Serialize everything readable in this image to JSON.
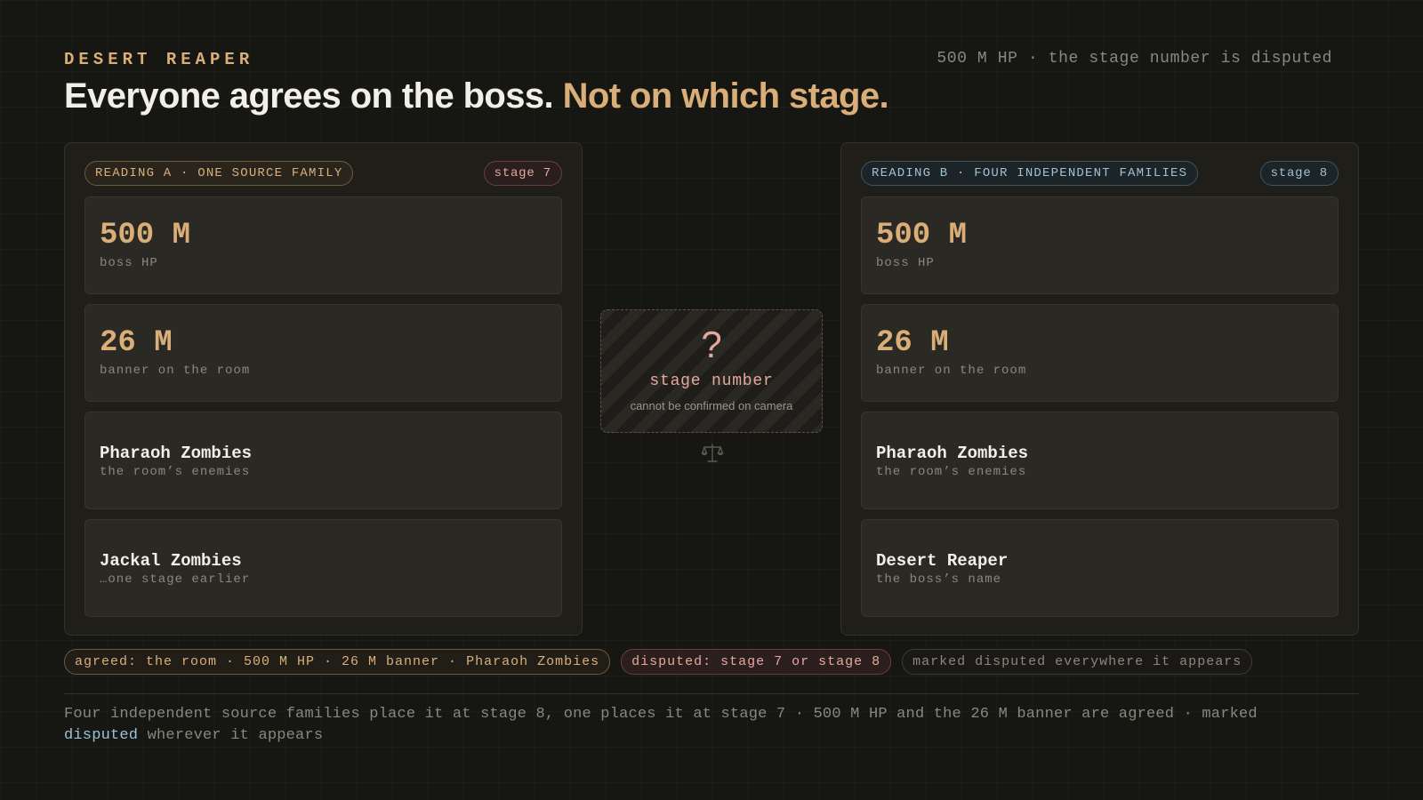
{
  "header": {
    "eyebrow": "DESERT REAPER",
    "meta": "500 M HP · the stage number is disputed",
    "headline_main": "Everyone agrees on the boss.",
    "headline_accent": "Not on which stage."
  },
  "reading_a": {
    "source_label": "READING A · ONE SOURCE FAMILY",
    "stage_label": "stage 7",
    "cards": [
      {
        "value": "500 M",
        "caption": "boss HP"
      },
      {
        "value": "26 M",
        "caption": "banner on the room"
      },
      {
        "value": "Pharaoh Zombies",
        "caption": "the room’s enemies"
      },
      {
        "value": "Jackal Zombies",
        "caption": "…one stage earlier"
      }
    ]
  },
  "reading_b": {
    "source_label": "READING B · FOUR INDEPENDENT FAMILIES",
    "stage_label": "stage 8",
    "cards": [
      {
        "value": "500 M",
        "caption": "boss HP"
      },
      {
        "value": "26 M",
        "caption": "banner on the room"
      },
      {
        "value": "Pharaoh Zombies",
        "caption": "the room’s enemies"
      },
      {
        "value": "Desert Reaper",
        "caption": "the boss’s name"
      }
    ]
  },
  "center": {
    "symbol": "?",
    "label": "stage number",
    "note": "cannot be confirmed on camera",
    "icon": "scale-icon"
  },
  "footer_pills": {
    "agreed": "agreed: the room · 500 M HP · 26 M banner · Pharaoh Zombies",
    "disputed": "disputed: stage 7 or stage 8",
    "marked": "marked disputed everywhere it appears"
  },
  "summary": {
    "before": "Four independent source families place it at stage 8, one places it at stage 7 · 500 M HP and the 26 M banner are agreed · marked ",
    "highlight": "disputed",
    "after": " wherever it appears"
  },
  "colors": {
    "background": "#161612",
    "accent_gold": "#d9ae78",
    "accent_rose": "#e6a7a0",
    "accent_blue": "#9cc2d6",
    "text_primary": "#f2efe8",
    "text_muted": "#8b877e"
  }
}
